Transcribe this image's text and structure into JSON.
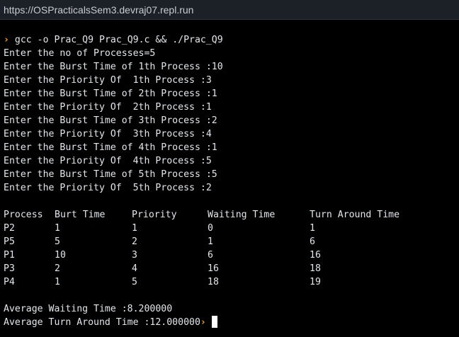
{
  "browser": {
    "url": "https://OSPracticalsSem3.devraj07.repl.run"
  },
  "terminal": {
    "prompt_symbol": "›",
    "command": "gcc -o Prac_Q9 Prac_Q9.c && ./Prac_Q9",
    "input_lines": [
      "Enter the no of Processes=5",
      "Enter the Burst Time of 1th Process :10",
      "Enter the Priority Of  1th Process :3",
      "Enter the Burst Time of 2th Process :1",
      "Enter the Priority Of  2th Process :1",
      "Enter the Burst Time of 3th Process :2",
      "Enter the Priority Of  3th Process :4",
      "Enter the Burst Time of 4th Process :1",
      "Enter the Priority Of  4th Process :5",
      "Enter the Burst Time of 5th Process :5",
      "Enter the Priority Of  5th Process :2"
    ],
    "table": {
      "headers": [
        "Process",
        "Burt Time",
        "Priority",
        "Waiting Time",
        "Turn Around Time"
      ],
      "rows": [
        [
          "P2",
          "1",
          "1",
          "0",
          "1"
        ],
        [
          "P5",
          "5",
          "2",
          "1",
          "6"
        ],
        [
          "P1",
          "10",
          "3",
          "6",
          "16"
        ],
        [
          "P3",
          "2",
          "4",
          "16",
          "18"
        ],
        [
          "P4",
          "1",
          "5",
          "18",
          "19"
        ]
      ]
    },
    "avg_waiting": "Average Waiting Time :8.200000",
    "avg_turnaround": "Average Turn Around Time :12.000000",
    "colors": {
      "prompt": "#f5a623",
      "text": "#e3e6ea",
      "background": "#000000",
      "url_bar": "#1c2027"
    }
  }
}
